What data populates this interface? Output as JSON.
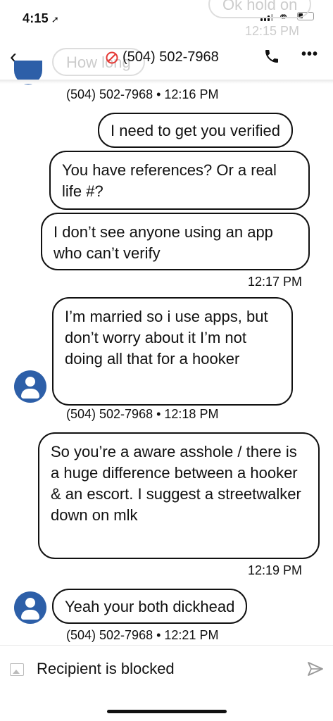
{
  "status_bar": {
    "time": "4:15",
    "location_glyph": "➚"
  },
  "ghost": {
    "top_bubble": "Ok hold on",
    "top_time": "12:15 PM",
    "left_bubble": "How long"
  },
  "header": {
    "contact": "(504) 502-7968"
  },
  "messages": [
    {
      "dir": "in_meta",
      "meta": "(504) 502-7968 • 12:16 PM"
    },
    {
      "dir": "out",
      "text": "I need to get you verified"
    },
    {
      "dir": "out",
      "text": "You have references? Or a real life #?"
    },
    {
      "dir": "out",
      "text": "I don’t see anyone using an app who can’t verify"
    },
    {
      "dir": "out_time",
      "meta": "12:17 PM"
    },
    {
      "dir": "in",
      "text": "I’m married so i use apps, but don’t worry about it I’m not doing all that for a hooker",
      "meta": "(504) 502-7968 • 12:18 PM"
    },
    {
      "dir": "out",
      "text": "So you’re a aware asshole / there is a huge difference between a hooker & an escort. I suggest a streetwalker down on mlk"
    },
    {
      "dir": "out_time",
      "meta": "12:19 PM"
    },
    {
      "dir": "in",
      "text": "Yeah your both dickhead",
      "meta": "(504) 502-7968 • 12:21 PM"
    }
  ],
  "composer": {
    "status": "Recipient is blocked"
  },
  "icons": {
    "back": "chevron-left-icon",
    "block": "block-icon",
    "call": "phone-icon",
    "more": "more-icon",
    "attach": "image-icon",
    "send": "send-icon"
  }
}
